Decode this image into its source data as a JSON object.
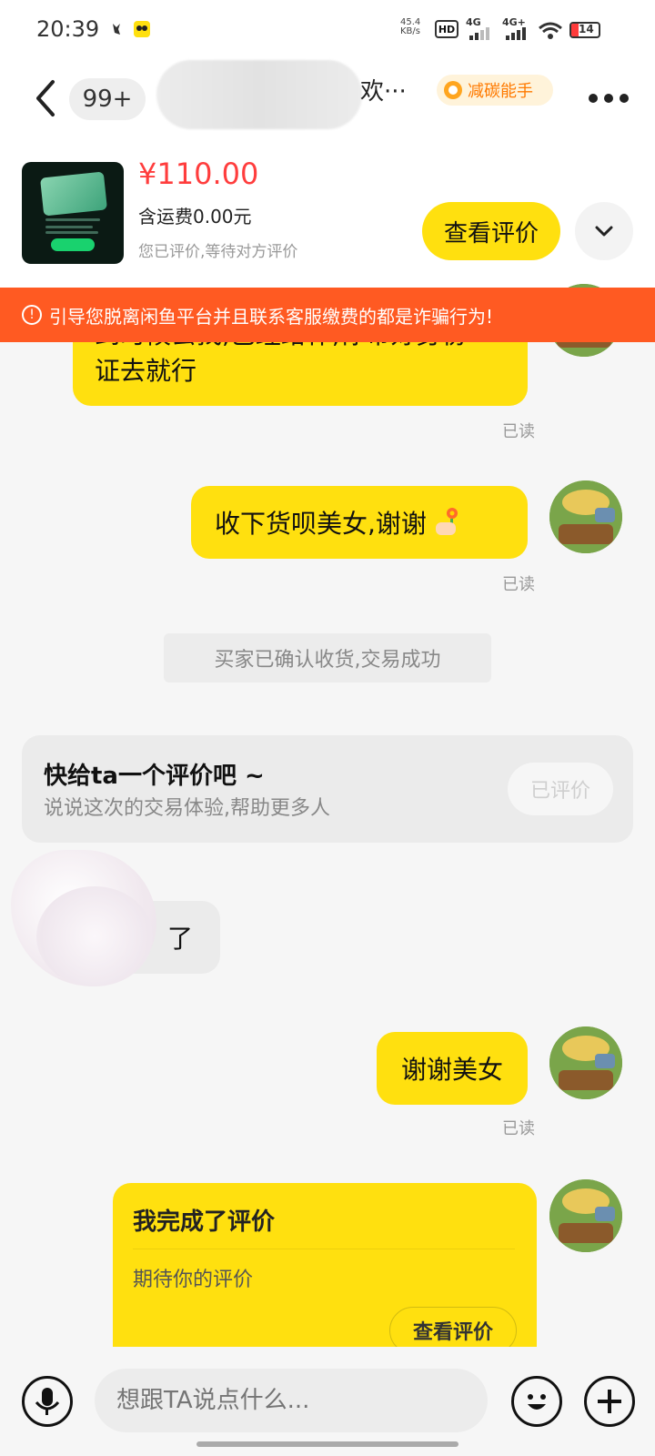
{
  "status_bar": {
    "time": "20:39",
    "net_speed_top": "45.4",
    "net_speed_bottom": "KB/s",
    "hd_label": "HD",
    "sim1": "4G",
    "sim2": "4G+",
    "battery": "14"
  },
  "header": {
    "unread_count": "99+",
    "name_tail": "欢···",
    "tag_label": "减碳能手"
  },
  "product": {
    "price": "¥110.00",
    "shipping": "含运费0.00元",
    "status": "您已评价,等待对方评价",
    "view_review_label": "查看评价"
  },
  "warning": {
    "text": "引导您脱离闲鱼平台并且联系客服缴费的都是诈骗行为!"
  },
  "messages": {
    "m1_line1": "到时候去找,已经给作,你带好身份",
    "m1_line2": "证去就行",
    "m1_read": "已读",
    "m2_text": "收下货呗美女,谢谢",
    "m2_read": "已读",
    "system": "买家已确认收货,交易成功",
    "review_prompt_title": "快给ta一个评价吧 ~",
    "review_prompt_sub": "说说这次的交易体验,帮助更多人",
    "review_prompt_btn": "已评价",
    "m3_text": "了",
    "m4_text": "谢谢美女",
    "m4_read": "已读",
    "complete_title": "我完成了评价",
    "complete_text": "期待你的评价",
    "complete_btn": "查看评价"
  },
  "input": {
    "placeholder": "想跟TA说点什么..."
  },
  "colors": {
    "accent": "#ffe00f",
    "warning": "#ff5a22",
    "price": "#ff3d3d"
  }
}
